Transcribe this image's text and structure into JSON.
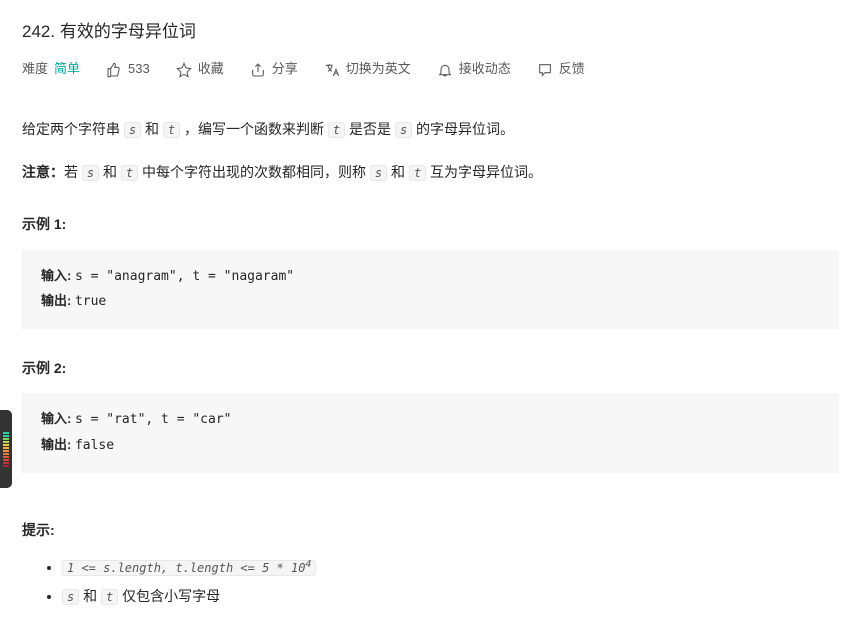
{
  "problem": {
    "number": "242",
    "title": "有效的字母异位词"
  },
  "meta": {
    "difficulty_label": "难度",
    "difficulty_value": "简单",
    "likes": "533",
    "favorite": "收藏",
    "share": "分享",
    "translate": "切换为英文",
    "notifications": "接收动态",
    "feedback": "反馈"
  },
  "body": {
    "p1_a": "给定两个字符串 ",
    "s": "s",
    "and": " 和 ",
    "t": "t",
    "p1_b": " ，编写一个函数来判断 ",
    "p1_c": " 是否是 ",
    "p1_d": " 的字母异位词。",
    "note_label": "注意：",
    "p2_a": "若 ",
    "p2_b": " 中每个字符出现的次数都相同，则称 ",
    "p2_c": " 互为字母异位词。"
  },
  "examples": [
    {
      "heading": "示例 1:",
      "input_label": "输入: ",
      "input": "s = \"anagram\", t = \"nagaram\"",
      "output_label": "输出: ",
      "output": "true"
    },
    {
      "heading": "示例 2:",
      "input_label": "输入: ",
      "input": "s = \"rat\", t = \"car\"",
      "output_label": "输出: ",
      "output": "false"
    }
  ],
  "hints": {
    "heading": "提示:",
    "item1_a": "1 <= s.length, t.length <= 5 * 10",
    "item1_sup": "4",
    "item2_a": "s",
    "item2_b": " 和 ",
    "item2_c": "t",
    "item2_d": " 仅包含小写字母"
  },
  "colors": {
    "bars": [
      "#2acfa8",
      "#2acfa8",
      "#7fd35a",
      "#b8d94a",
      "#e8d33a",
      "#f0b53a",
      "#f0953a",
      "#ee7a3a",
      "#e8553a",
      "#d4443a",
      "#c0333a",
      "#a82a3a"
    ]
  }
}
